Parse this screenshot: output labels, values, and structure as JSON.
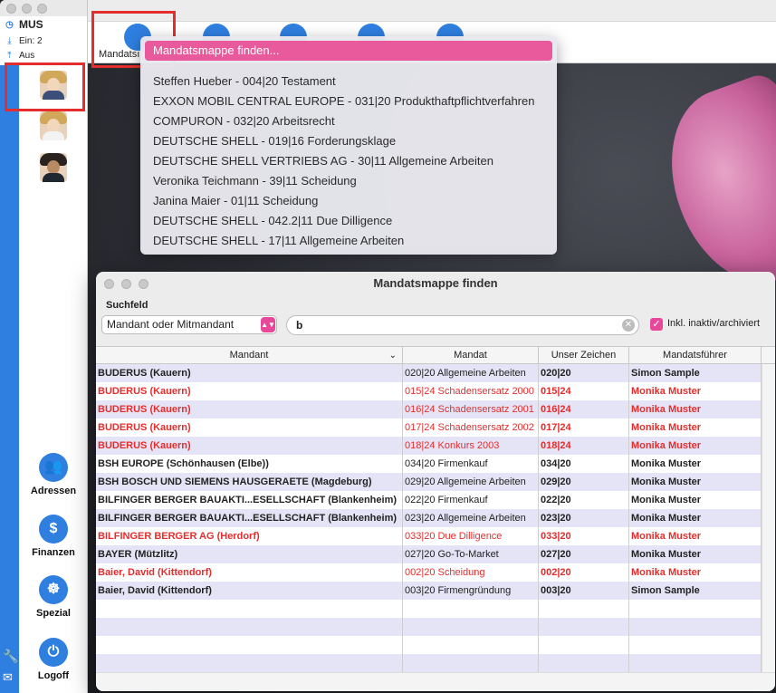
{
  "sidebar": {
    "user": "MUS",
    "inbox": "Ein: 2",
    "outbox": "Aus",
    "nav": [
      {
        "label": "Adressen"
      },
      {
        "label": "Finanzen"
      },
      {
        "label": "Spezial"
      },
      {
        "label": "Logoff"
      }
    ]
  },
  "toolbar": {
    "first_label": "Mandatsı"
  },
  "dropdown": {
    "selected": "Mandatsmappe finden...",
    "items": [
      "Steffen Hueber - 004|20 Testament",
      "EXXON MOBIL CENTRAL EUROPE - 031|20 Produkthaftpflichtverfahren",
      "COMPURON - 032|20 Arbeitsrecht",
      "DEUTSCHE SHELL - 019|16 Forderungsklage",
      "DEUTSCHE SHELL VERTRIEBS AG - 30|11 Allgemeine Arbeiten",
      "Veronika Teichmann - 39|11 Scheidung",
      "Janina Maier - 01|11 Scheidung",
      "DEUTSCHE SHELL - 042.2|11 Due Dilligence",
      "DEUTSCHE SHELL - 17|11 Allgemeine Arbeiten"
    ]
  },
  "dialog": {
    "title": "Mandatsmappe finden",
    "suchfeld_label": "Suchfeld",
    "select_value": "Mandant oder Mitmandant",
    "search_value": "b",
    "checkbox_label": "Inkl. inaktiv/archiviert",
    "columns": [
      "Mandant",
      "Mandat",
      "Unser Zeichen",
      "Mandatsführer"
    ],
    "rows": [
      {
        "mandant": "BUDERUS (Kauern)",
        "mandat": "020|20 Allgemeine Arbeiten",
        "zeichen": "020|20",
        "fuehrer": "Simon Sample",
        "red": false
      },
      {
        "mandant": "BUDERUS (Kauern)",
        "mandat": "015|24 Schadensersatz 2000",
        "zeichen": "015|24",
        "fuehrer": "Monika Muster",
        "red": true
      },
      {
        "mandant": "BUDERUS (Kauern)",
        "mandat": "016|24 Schadensersatz 2001",
        "zeichen": "016|24",
        "fuehrer": "Monika Muster",
        "red": true
      },
      {
        "mandant": "BUDERUS (Kauern)",
        "mandat": "017|24 Schadensersatz 2002",
        "zeichen": "017|24",
        "fuehrer": "Monika Muster",
        "red": true
      },
      {
        "mandant": "BUDERUS (Kauern)",
        "mandat": "018|24 Konkurs 2003",
        "zeichen": "018|24",
        "fuehrer": "Monika Muster",
        "red": true
      },
      {
        "mandant": "BSH EUROPE (Schönhausen (Elbe))",
        "mandat": "034|20 Firmenkauf",
        "zeichen": "034|20",
        "fuehrer": "Monika Muster",
        "red": false
      },
      {
        "mandant": "BSH BOSCH UND SIEMENS HAUSGERAETE (Magdeburg)",
        "mandat": "029|20 Allgemeine Arbeiten",
        "zeichen": "029|20",
        "fuehrer": "Monika Muster",
        "red": false
      },
      {
        "mandant": "BILFINGER BERGER BAUAKTI...ESELLSCHAFT (Blankenheim)",
        "mandat": "022|20 Firmenkauf",
        "zeichen": "022|20",
        "fuehrer": "Monika Muster",
        "red": false
      },
      {
        "mandant": "BILFINGER BERGER BAUAKTI...ESELLSCHAFT (Blankenheim)",
        "mandat": "023|20 Allgemeine Arbeiten",
        "zeichen": "023|20",
        "fuehrer": "Monika Muster",
        "red": false
      },
      {
        "mandant": "BILFINGER BERGER AG (Herdorf)",
        "mandat": "033|20 Due Dilligence",
        "zeichen": "033|20",
        "fuehrer": "Monika Muster",
        "red": true
      },
      {
        "mandant": "BAYER (Mützlitz)",
        "mandat": "027|20 Go-To-Market",
        "zeichen": "027|20",
        "fuehrer": "Monika Muster",
        "red": false
      },
      {
        "mandant": "Baier, David (Kittendorf)",
        "mandat": "002|20 Scheidung",
        "zeichen": "002|20",
        "fuehrer": "Monika Muster",
        "red": true
      },
      {
        "mandant": "Baier, David (Kittendorf)",
        "mandat": "003|20 Firmengründung",
        "zeichen": "003|20",
        "fuehrer": "Simon Sample",
        "red": false
      }
    ]
  },
  "colors": {
    "accent": "#2f7fe0",
    "highlight": "#e85a9b",
    "alert_red": "#e42d2d"
  }
}
